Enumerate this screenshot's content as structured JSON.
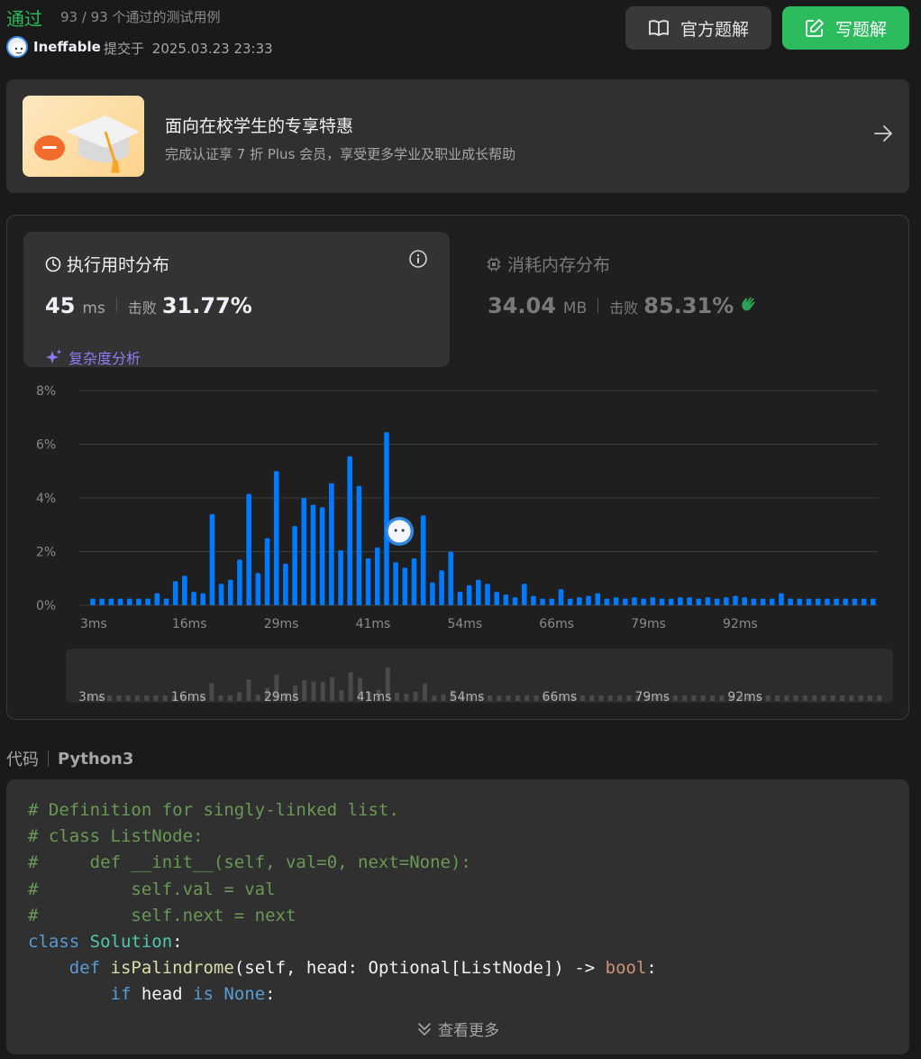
{
  "header": {
    "status": "通过",
    "pass_count": "93 / 93 个通过的测试用例",
    "username": "Ineffable",
    "submitted_label": "提交于",
    "submitted_time": "2025.03.23 23:33",
    "official_solution_label": "官方题解",
    "write_solution_label": "写题解"
  },
  "promo": {
    "title": "面向在校学生的专享特惠",
    "subtitle": "完成认证享 7 折 Plus 会员，享受更多学业及职业成长帮助"
  },
  "runtime": {
    "title": "执行用时分布",
    "value": "45",
    "unit": "ms",
    "beat_label": "击败",
    "beat_pct": "31.77%",
    "analysis_label": "复杂度分析"
  },
  "memory": {
    "title": "消耗内存分布",
    "value": "34.04",
    "unit": "MB",
    "beat_label": "击败",
    "beat_pct": "85.31%"
  },
  "code": {
    "label": "代码",
    "language": "Python3",
    "more_label": "查看更多"
  },
  "colors": {
    "accent_green": "#2cbb5d",
    "bar_blue": "#007aff",
    "purple": "#8b7cf6"
  },
  "chart_data": {
    "type": "bar",
    "title": "执行用时分布",
    "xlabel": "",
    "ylabel": "",
    "ylim": [
      0,
      8
    ],
    "y_ticks": [
      "0%",
      "2%",
      "4%",
      "6%",
      "8%"
    ],
    "x_tick_labels": [
      "3ms",
      "16ms",
      "29ms",
      "41ms",
      "54ms",
      "66ms",
      "79ms",
      "92ms"
    ],
    "grid": true,
    "user_marker_index": 33,
    "series": [
      {
        "values": [
          0.25,
          0.25,
          0.25,
          0.25,
          0.25,
          0.25,
          0.25,
          0.45,
          0.25,
          0.9,
          1.1,
          0.5,
          0.45,
          3.4,
          0.8,
          0.95,
          1.7,
          4.15,
          1.2,
          2.5,
          5.0,
          1.55,
          2.95,
          4.0,
          3.75,
          3.65,
          4.55,
          2.05,
          5.55,
          4.45,
          1.75,
          2.15,
          6.45,
          1.6,
          1.4,
          1.75,
          3.35,
          0.85,
          1.3,
          2.0,
          0.5,
          0.75,
          0.95,
          0.8,
          0.5,
          0.4,
          0.3,
          0.8,
          0.35,
          0.25,
          0.25,
          0.6,
          0.25,
          0.3,
          0.35,
          0.45,
          0.25,
          0.3,
          0.25,
          0.3,
          0.25,
          0.3,
          0.25,
          0.25,
          0.3,
          0.3,
          0.25,
          0.3,
          0.25,
          0.3,
          0.35,
          0.3,
          0.25,
          0.25,
          0.25,
          0.45,
          0.25,
          0.25,
          0.25,
          0.25,
          0.25,
          0.25,
          0.25,
          0.25,
          0.25,
          0.25
        ]
      }
    ]
  }
}
